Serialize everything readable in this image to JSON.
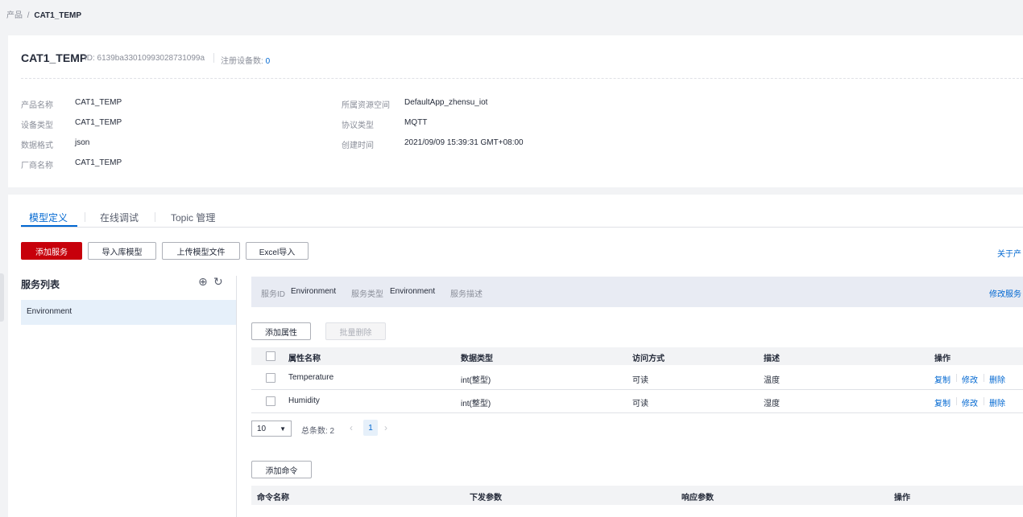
{
  "breadcrumb": {
    "parent": "产品",
    "separator": "/",
    "current": "CAT1_TEMP"
  },
  "product": {
    "title": "CAT1_TEMP",
    "id_text": "ID: 6139ba33010993028731099a",
    "registered_label": "注册设备数:",
    "registered_count": "0",
    "fields_left": [
      {
        "label": "产品名称",
        "value": "CAT1_TEMP"
      },
      {
        "label": "设备类型",
        "value": "CAT1_TEMP"
      },
      {
        "label": "数据格式",
        "value": "json"
      },
      {
        "label": "厂商名称",
        "value": "CAT1_TEMP"
      }
    ],
    "fields_right": [
      {
        "label": "所属资源空间",
        "value": "DefaultApp_zhensu_iot"
      },
      {
        "label": "协议类型",
        "value": "MQTT"
      },
      {
        "label": "创建时间",
        "value": "2021/09/09 15:39:31 GMT+08:00"
      }
    ]
  },
  "tabs": [
    {
      "label": "模型定义",
      "active": true
    },
    {
      "label": "在线调试",
      "active": false
    },
    {
      "label": "Topic 管理",
      "active": false
    }
  ],
  "toolbar": {
    "add_service": "添加服务",
    "import_library": "导入库模型",
    "upload_model": "上传模型文件",
    "excel_import": "Excel导入",
    "about_link": "关于产"
  },
  "service_list": {
    "title": "服务列表",
    "items": [
      "Environment"
    ]
  },
  "service_info": {
    "id_label": "服务ID",
    "id_value": "Environment",
    "type_label": "服务类型",
    "type_value": "Environment",
    "desc_label": "服务描述",
    "modify_link": "修改服务"
  },
  "properties": {
    "add_button": "添加属性",
    "batch_delete_button": "批量删除",
    "columns": [
      "属性名称",
      "数据类型",
      "访问方式",
      "描述",
      "操作"
    ],
    "rows": [
      {
        "name": "Temperature",
        "type": "int(整型)",
        "access": "可读",
        "desc": "温度"
      },
      {
        "name": "Humidity",
        "type": "int(整型)",
        "access": "可读",
        "desc": "湿度"
      }
    ],
    "ops": {
      "copy": "复制",
      "edit": "修改",
      "delete": "删除"
    }
  },
  "pager": {
    "page_size": "10",
    "total_label": "总条数: 2",
    "current_page": "1",
    "prev": "‹",
    "next": "›"
  },
  "commands": {
    "add_button": "添加命令",
    "columns": [
      "命令名称",
      "下发参数",
      "响应参数",
      "操作"
    ]
  },
  "colors": {
    "accent": "#0067d1",
    "primary_button": "#c7000b"
  },
  "icons": {
    "add": "add-circle-icon",
    "refresh": "refresh-icon",
    "dropdown": "caret-down-icon"
  }
}
